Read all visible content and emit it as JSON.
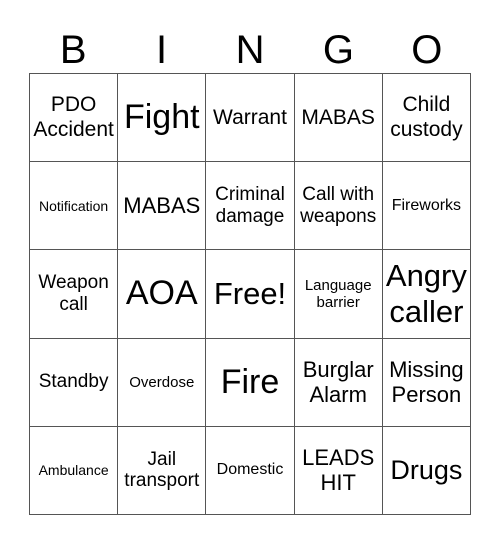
{
  "header": [
    "B",
    "I",
    "N",
    "G",
    "O"
  ],
  "cells": [
    [
      "PDO Accident",
      "Fight",
      "Warrant",
      "MABAS",
      "Child custody"
    ],
    [
      "Notification",
      "MABAS",
      "Criminal damage",
      "Call with weapons",
      "Fireworks"
    ],
    [
      "Weapon call",
      "AOA",
      "Free!",
      "Language barrier",
      "Angry caller"
    ],
    [
      "Standby",
      "Overdose",
      "Fire",
      "Burglar Alarm",
      "Missing Person"
    ],
    [
      "Ambulance",
      "Jail transport",
      "Domestic",
      "LEADS HIT",
      "Drugs"
    ]
  ]
}
